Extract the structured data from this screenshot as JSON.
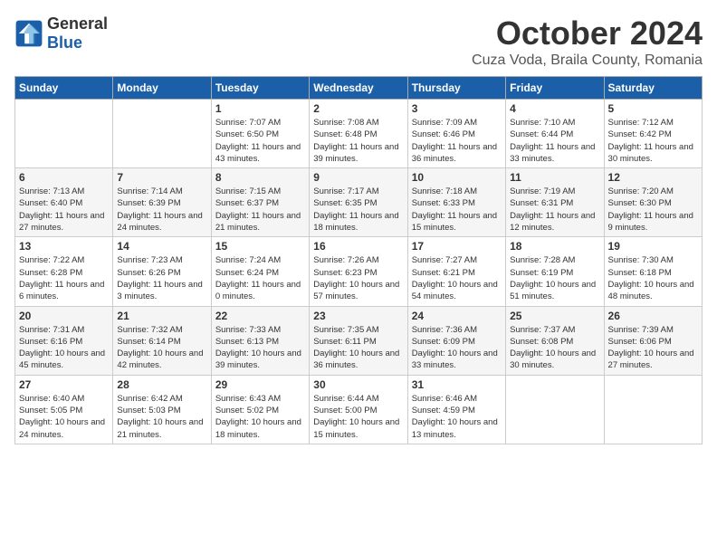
{
  "header": {
    "logo_general": "General",
    "logo_blue": "Blue",
    "month": "October 2024",
    "location": "Cuza Voda, Braila County, Romania"
  },
  "weekdays": [
    "Sunday",
    "Monday",
    "Tuesday",
    "Wednesday",
    "Thursday",
    "Friday",
    "Saturday"
  ],
  "weeks": [
    [
      {
        "day": "",
        "info": ""
      },
      {
        "day": "",
        "info": ""
      },
      {
        "day": "1",
        "info": "Sunrise: 7:07 AM\nSunset: 6:50 PM\nDaylight: 11 hours and 43 minutes."
      },
      {
        "day": "2",
        "info": "Sunrise: 7:08 AM\nSunset: 6:48 PM\nDaylight: 11 hours and 39 minutes."
      },
      {
        "day": "3",
        "info": "Sunrise: 7:09 AM\nSunset: 6:46 PM\nDaylight: 11 hours and 36 minutes."
      },
      {
        "day": "4",
        "info": "Sunrise: 7:10 AM\nSunset: 6:44 PM\nDaylight: 11 hours and 33 minutes."
      },
      {
        "day": "5",
        "info": "Sunrise: 7:12 AM\nSunset: 6:42 PM\nDaylight: 11 hours and 30 minutes."
      }
    ],
    [
      {
        "day": "6",
        "info": "Sunrise: 7:13 AM\nSunset: 6:40 PM\nDaylight: 11 hours and 27 minutes."
      },
      {
        "day": "7",
        "info": "Sunrise: 7:14 AM\nSunset: 6:39 PM\nDaylight: 11 hours and 24 minutes."
      },
      {
        "day": "8",
        "info": "Sunrise: 7:15 AM\nSunset: 6:37 PM\nDaylight: 11 hours and 21 minutes."
      },
      {
        "day": "9",
        "info": "Sunrise: 7:17 AM\nSunset: 6:35 PM\nDaylight: 11 hours and 18 minutes."
      },
      {
        "day": "10",
        "info": "Sunrise: 7:18 AM\nSunset: 6:33 PM\nDaylight: 11 hours and 15 minutes."
      },
      {
        "day": "11",
        "info": "Sunrise: 7:19 AM\nSunset: 6:31 PM\nDaylight: 11 hours and 12 minutes."
      },
      {
        "day": "12",
        "info": "Sunrise: 7:20 AM\nSunset: 6:30 PM\nDaylight: 11 hours and 9 minutes."
      }
    ],
    [
      {
        "day": "13",
        "info": "Sunrise: 7:22 AM\nSunset: 6:28 PM\nDaylight: 11 hours and 6 minutes."
      },
      {
        "day": "14",
        "info": "Sunrise: 7:23 AM\nSunset: 6:26 PM\nDaylight: 11 hours and 3 minutes."
      },
      {
        "day": "15",
        "info": "Sunrise: 7:24 AM\nSunset: 6:24 PM\nDaylight: 11 hours and 0 minutes."
      },
      {
        "day": "16",
        "info": "Sunrise: 7:26 AM\nSunset: 6:23 PM\nDaylight: 10 hours and 57 minutes."
      },
      {
        "day": "17",
        "info": "Sunrise: 7:27 AM\nSunset: 6:21 PM\nDaylight: 10 hours and 54 minutes."
      },
      {
        "day": "18",
        "info": "Sunrise: 7:28 AM\nSunset: 6:19 PM\nDaylight: 10 hours and 51 minutes."
      },
      {
        "day": "19",
        "info": "Sunrise: 7:30 AM\nSunset: 6:18 PM\nDaylight: 10 hours and 48 minutes."
      }
    ],
    [
      {
        "day": "20",
        "info": "Sunrise: 7:31 AM\nSunset: 6:16 PM\nDaylight: 10 hours and 45 minutes."
      },
      {
        "day": "21",
        "info": "Sunrise: 7:32 AM\nSunset: 6:14 PM\nDaylight: 10 hours and 42 minutes."
      },
      {
        "day": "22",
        "info": "Sunrise: 7:33 AM\nSunset: 6:13 PM\nDaylight: 10 hours and 39 minutes."
      },
      {
        "day": "23",
        "info": "Sunrise: 7:35 AM\nSunset: 6:11 PM\nDaylight: 10 hours and 36 minutes."
      },
      {
        "day": "24",
        "info": "Sunrise: 7:36 AM\nSunset: 6:09 PM\nDaylight: 10 hours and 33 minutes."
      },
      {
        "day": "25",
        "info": "Sunrise: 7:37 AM\nSunset: 6:08 PM\nDaylight: 10 hours and 30 minutes."
      },
      {
        "day": "26",
        "info": "Sunrise: 7:39 AM\nSunset: 6:06 PM\nDaylight: 10 hours and 27 minutes."
      }
    ],
    [
      {
        "day": "27",
        "info": "Sunrise: 6:40 AM\nSunset: 5:05 PM\nDaylight: 10 hours and 24 minutes."
      },
      {
        "day": "28",
        "info": "Sunrise: 6:42 AM\nSunset: 5:03 PM\nDaylight: 10 hours and 21 minutes."
      },
      {
        "day": "29",
        "info": "Sunrise: 6:43 AM\nSunset: 5:02 PM\nDaylight: 10 hours and 18 minutes."
      },
      {
        "day": "30",
        "info": "Sunrise: 6:44 AM\nSunset: 5:00 PM\nDaylight: 10 hours and 15 minutes."
      },
      {
        "day": "31",
        "info": "Sunrise: 6:46 AM\nSunset: 4:59 PM\nDaylight: 10 hours and 13 minutes."
      },
      {
        "day": "",
        "info": ""
      },
      {
        "day": "",
        "info": ""
      }
    ]
  ]
}
